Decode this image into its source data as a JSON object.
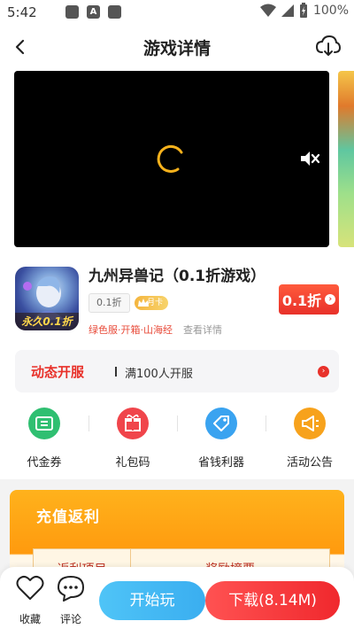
{
  "status_bar": {
    "time": "5:42",
    "notif_a": "A",
    "battery_text": "100%"
  },
  "header": {
    "title": "游戏详情",
    "back_icon": "back-arrow-icon",
    "download_icon": "cloud-download-icon"
  },
  "video": {
    "state": "loading",
    "muted": true
  },
  "game": {
    "title": "九州异兽记（0.1折游戏）",
    "discount_tag": "0.1折",
    "vip_badge": "月卡",
    "icon_badge": "永久0.1折",
    "tags": "绿色服·开箱·山海经",
    "detail_link": "查看详情",
    "price_button": "0.1折"
  },
  "server": {
    "label": "动态开服",
    "text": "满100人开服"
  },
  "quick_nav": [
    {
      "label": "代金券",
      "icon": "voucher-icon",
      "color": "#2fbf71"
    },
    {
      "label": "礼包码",
      "icon": "gift-icon",
      "color": "#f0454b"
    },
    {
      "label": "省钱利器",
      "icon": "tag-icon",
      "color": "#3aa3f0"
    },
    {
      "label": "活动公告",
      "icon": "megaphone-icon",
      "color": "#f7a21c"
    }
  ],
  "rebate": {
    "title": "充值返利",
    "col1": "返利项目",
    "col2": "奖励摘要"
  },
  "bottom_bar": {
    "favorite": "收藏",
    "comment": "评论",
    "play": "开始玩",
    "download": "下载(8.14M)"
  },
  "colors": {
    "accent_red": "#e8312a",
    "accent_blue": "#3aaef0",
    "accent_orange": "#ff9a0e"
  }
}
